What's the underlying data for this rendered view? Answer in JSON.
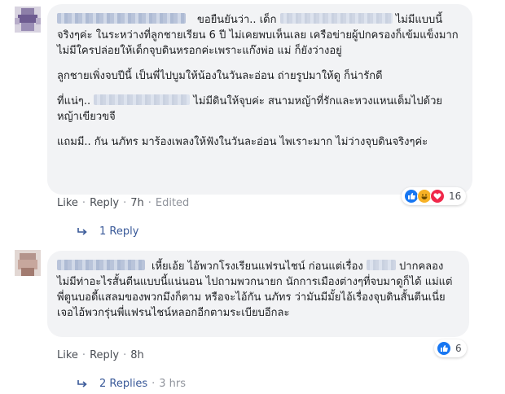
{
  "comment1": {
    "author": "",
    "paragraphs": [
      [
        "ขอยืนยันว่า.. เด็ก",
        "ไม่มีแบบนี้จริงๆค่ะ ในระหว่างที่ลูกชายเรียน 6 ปี ไม่เคยพบเห็นเลย เครือข่ายผู้ปกครองก็เข้มแข็งมาก ไม่มีใครปล่อยให้เด็กจุบดินหรอกค่ะเพราะแก๊งพ่อ แม่ ก็ยังว่างอยู่"
      ],
      [
        "ลูกชายเพิ่งจบปีนี้ เป็นพี่ไปบูมให้น้องในวันละอ่อน ถ่ายรูปมาให้ดู ก็น่ารักดี"
      ],
      [
        "ที่แน่ๆ..",
        "ไม่มีดินให้จุบค่ะ สนามหญ้าที่รักและหวงแหนเต็มไปด้วยหญ้าเขียวขจี"
      ],
      [
        "แถมมี.. กัน นภัทร มาร้องเพลงให้ฟังในวันละอ่อน ไพเราะมาก ไม่ว่างจุบดินจริงๆค่ะ"
      ]
    ],
    "actions": {
      "like": "Like",
      "reply": "Reply",
      "time": "7h",
      "edited": "Edited"
    },
    "reaction_count": "16",
    "replies_label": "1 Reply"
  },
  "comment2": {
    "author": "",
    "text_a": "เหี้ยเอ้ย ไอ้พวกโรงเรียนแฟรนไชน์ ก่อนแต่เรื่อง",
    "text_b": "ปากคลองไม่มีท่าอะไรสั้นตีนแบบนี้แน่นอน ไปถามพวกนายก นักการเมืองต่างๆที่จบมาดูก็ได้ แม่แต่พี่ตูนบอดี้แสลมของพวกมึงก็ตาม หรือจะไอ้กัน นภัทร ว่ามันมีมั้ยไอ้เรื่องจุบดินสั้นตีนเนี่ย เจอไอ้พวกรุ่นพี่แฟรนไชน์หลอกอีกตามระเบียบอีกละ",
    "actions": {
      "like": "Like",
      "reply": "Reply",
      "time": "8h"
    },
    "reaction_count": "6",
    "replies_label": "2 Replies",
    "replies_time": "3 hrs"
  },
  "colors": {
    "link": "#385898",
    "like_blue": "#1877f2",
    "haha_yellow": "#f7b125",
    "love_red": "#f0284a"
  }
}
